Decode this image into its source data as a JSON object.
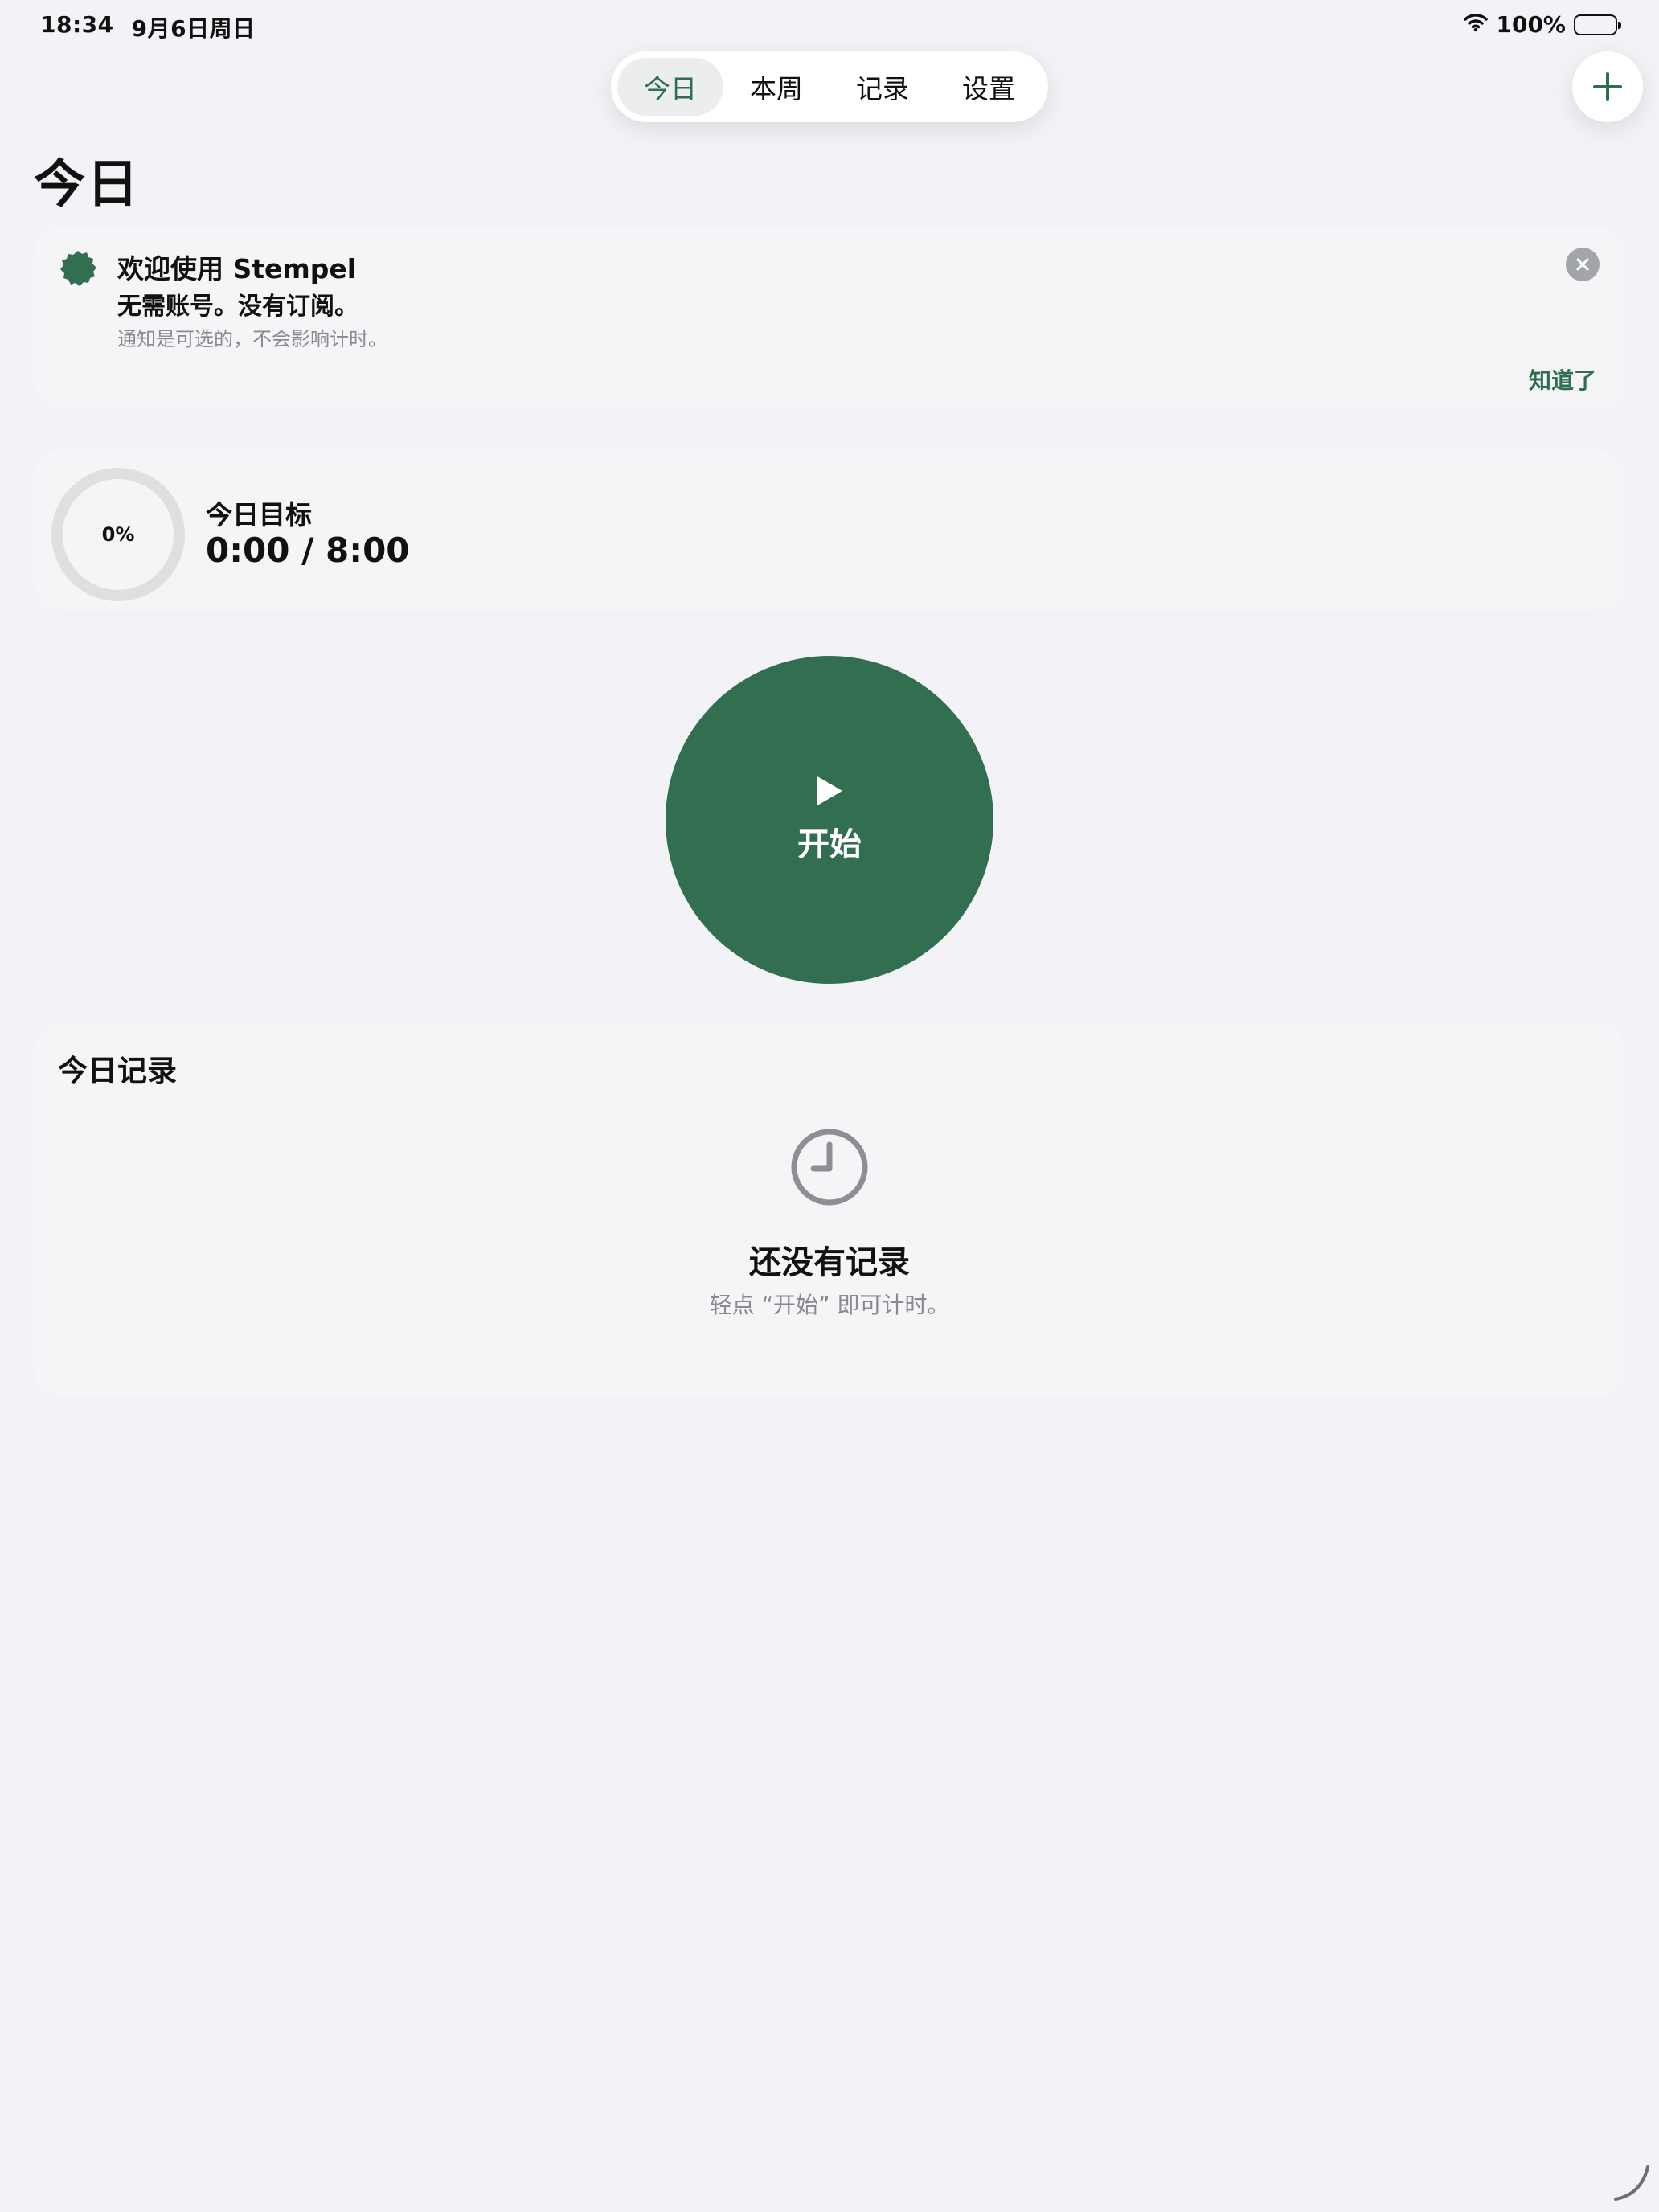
{
  "status_bar": {
    "time": "18:34",
    "date": "9月6日周日",
    "battery": "100%"
  },
  "tabs": [
    {
      "label": "今日",
      "active": true
    },
    {
      "label": "本周",
      "active": false
    },
    {
      "label": "记录",
      "active": false
    },
    {
      "label": "设置",
      "active": false
    }
  ],
  "add_button_icon": "plus-icon",
  "page_title": "今日",
  "welcome": {
    "title": "欢迎使用 Stempel",
    "subtitle": "无需账号。没有订阅。",
    "note": "通知是可选的，不会影响计时。",
    "dismiss": "知道了"
  },
  "goal": {
    "progress_label": "0%",
    "progress": 0,
    "title": "今日目标",
    "value": "0:00 / 8:00"
  },
  "start_button": {
    "label": "开始",
    "icon": "play-icon"
  },
  "records": {
    "title": "今日记录",
    "empty_icon": "clock-icon",
    "empty_title": "还没有记录",
    "empty_hint": "轻点 “开始” 即可计时。"
  },
  "colors": {
    "accent": "#2f6e50",
    "start_button": "#316f50",
    "background": "#f2f2f7"
  }
}
